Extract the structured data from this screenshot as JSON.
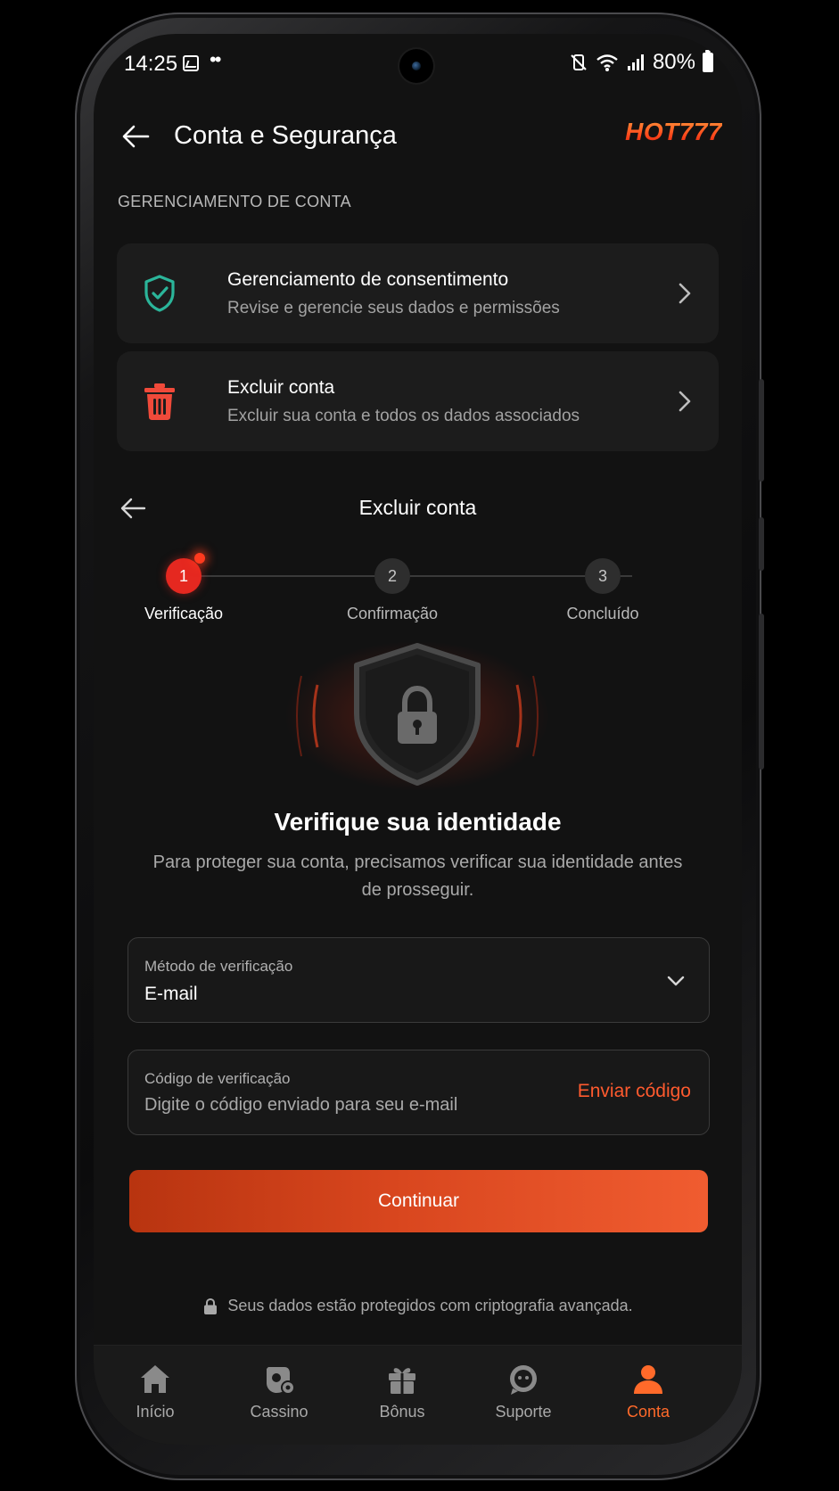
{
  "status_bar": {
    "time": "14:25",
    "dots": "••",
    "battery": "80%",
    "icons": [
      "image-icon",
      "vibrate-mute-icon",
      "wifi-icon",
      "signal-icon",
      "battery-icon"
    ]
  },
  "header": {
    "title": "Conta e Segurança",
    "brand": "HOT777"
  },
  "account_section": {
    "label": "GERENCIAMENTO DE CONTA",
    "items": [
      {
        "title": "Gerenciamento de consentimento",
        "subtitle": "Revise e gerencie seus dados e permissões",
        "icon": "shield-check-icon",
        "icon_color": "#2bb59a"
      },
      {
        "title": "Excluir conta",
        "subtitle": "Excluir sua conta e todos os dados associados",
        "icon": "trash-icon",
        "icon_color": "#f04a3a"
      }
    ]
  },
  "delete_sheet": {
    "title": "Excluir conta",
    "steps": [
      {
        "number": "1",
        "label": "Verificação",
        "active": true
      },
      {
        "number": "2",
        "label": "Confirmação",
        "active": false
      },
      {
        "number": "3",
        "label": "Concluído",
        "active": false
      }
    ],
    "heading": "Verifique sua identidade",
    "description": "Para proteger sua conta, precisamos verificar sua identidade antes de prosseguir.",
    "method_field": {
      "label": "Método de verificação",
      "value": "E-mail"
    },
    "code_field": {
      "label": "Código de verificação",
      "placeholder": "Digite o código enviado para seu e-mail",
      "action": "Enviar código"
    },
    "continue_label": "Continuar",
    "secure_note": "Seus dados estão protegidos com criptografia avançada."
  },
  "bottom_nav": {
    "items": [
      {
        "label": "Início",
        "icon": "home-icon",
        "active": false
      },
      {
        "label": "Cassino",
        "icon": "casino-chip-icon",
        "active": false
      },
      {
        "label": "Bônus",
        "icon": "gift-icon",
        "active": false
      },
      {
        "label": "Suporte",
        "icon": "support-chat-icon",
        "active": false
      },
      {
        "label": "Conta",
        "icon": "user-icon",
        "active": true
      }
    ]
  },
  "colors": {
    "accent": "#ff5a2e",
    "step_active": "#e52820",
    "background": "#121212",
    "card": "#1c1c1c"
  }
}
